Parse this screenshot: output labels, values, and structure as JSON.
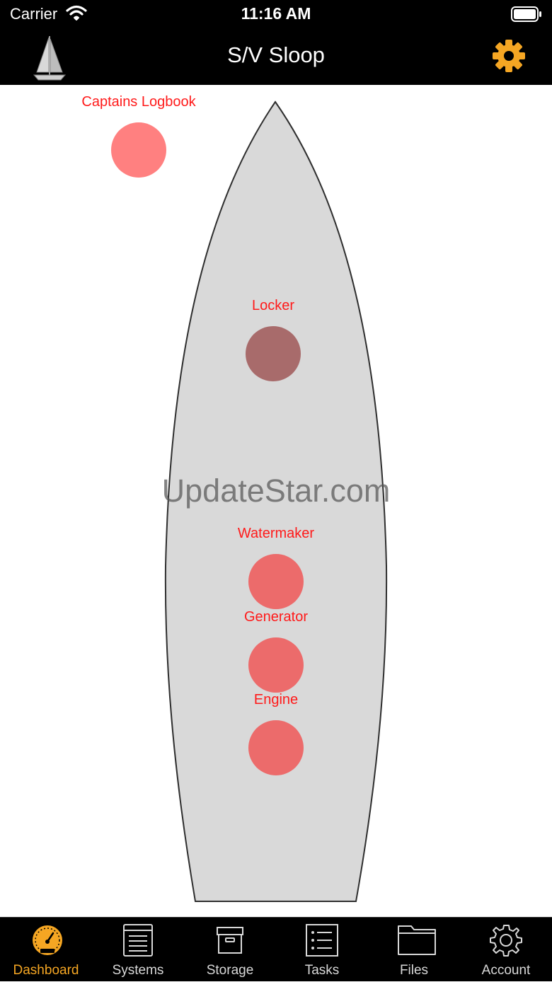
{
  "status_bar": {
    "carrier": "Carrier",
    "time": "11:16 AM"
  },
  "header": {
    "title": "S/V Sloop",
    "logo_icon": "sailboat-icon",
    "settings_icon": "gear-icon",
    "accent_color": "#f5a623"
  },
  "hotspots": [
    {
      "label": "Captains Logbook",
      "color": "#ff8080"
    },
    {
      "label": "Locker",
      "color": "#a86b6b"
    },
    {
      "label": "Watermaker",
      "color": "#ec6b6b"
    },
    {
      "label": "Generator",
      "color": "#ec6b6b"
    },
    {
      "label": "Engine",
      "color": "#ec6b6b"
    }
  ],
  "watermark": "UpdateStar.com",
  "tabs": [
    {
      "label": "Dashboard",
      "icon": "speedometer-icon",
      "active": true
    },
    {
      "label": "Systems",
      "icon": "list-document-icon",
      "active": false
    },
    {
      "label": "Storage",
      "icon": "archive-box-icon",
      "active": false
    },
    {
      "label": "Tasks",
      "icon": "checklist-icon",
      "active": false
    },
    {
      "label": "Files",
      "icon": "folder-icon",
      "active": false
    },
    {
      "label": "Account",
      "icon": "gear-outline-icon",
      "active": false
    }
  ]
}
